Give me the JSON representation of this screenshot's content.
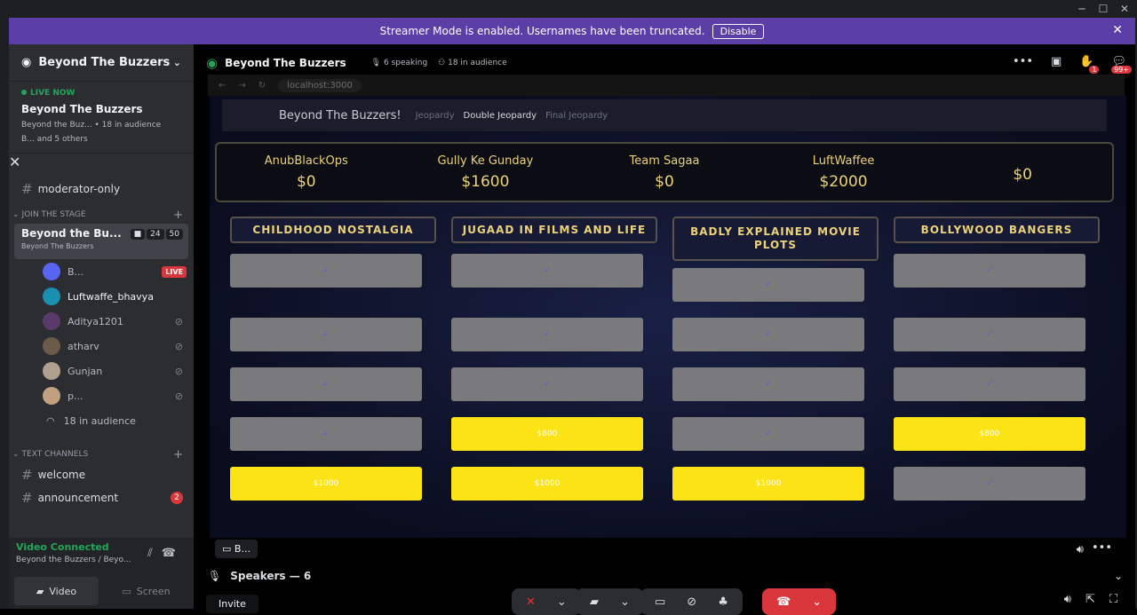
{
  "banner": {
    "text": "Streamer Mode is enabled. Usernames have been truncated.",
    "disable": "Disable"
  },
  "sidebar": {
    "server_name": "Beyond The Buzzers",
    "live": {
      "tag": "LIVE NOW",
      "name": "Beyond The Buzzers",
      "meta": "Beyond the Buz... • 18 in audience",
      "others": "B... and 5 others"
    },
    "channel_moderator": "moderator-only",
    "cat_stage": "JOIN THE STAGE",
    "stage_name": "Beyond the Bu...",
    "stage_sub": "Beyond The Buzzers",
    "stage_count1": "24",
    "stage_count2": "50",
    "users": [
      {
        "name": "B...",
        "live": "LIVE"
      },
      {
        "name": "Luftwaffe_bhavya"
      },
      {
        "name": "Aditya1201"
      },
      {
        "name": "atharv"
      },
      {
        "name": "Gunjan"
      },
      {
        "name": "p..."
      }
    ],
    "audience": "18 in audience",
    "cat_text": "TEXT CHANNELS",
    "channel_welcome": "welcome",
    "channel_announcement": "announcement",
    "announcement_badge": "2",
    "voice_connected": "Video Connected",
    "voice_sub": "Beyond the Buzzers / Beyo...",
    "btn_video": "Video",
    "btn_screen": "Screen"
  },
  "stage": {
    "title": "Beyond The Buzzers",
    "speaking": "6 speaking",
    "audience": "18 in audience",
    "notif_count": "1",
    "inbox_count": "99+",
    "url": "localhost:3000",
    "sharer": "B...",
    "speakers": "Speakers — 6",
    "invite": "Invite"
  },
  "game": {
    "brand": "Beyond The Buzzers!",
    "nav": [
      "Jeopardy",
      "Double Jeopardy",
      "Final Jeopardy"
    ],
    "teams": [
      {
        "name": "AnubBlackOps",
        "score": "$0"
      },
      {
        "name": "Gully Ke Gunday",
        "score": "$1600"
      },
      {
        "name": "Team Sagaa",
        "score": "$0"
      },
      {
        "name": "LuftWaffee",
        "score": "$2000"
      },
      {
        "name": "",
        "score": "$0"
      }
    ],
    "categories": [
      "CHILDHOOD NOSTALGIA",
      "JUGAAD IN FILMS AND LIFE",
      "BADLY EXPLAINED MOVIE PLOTS",
      "BOLLYWOOD BANGERS"
    ],
    "check": "✔",
    "open_cells": {
      "c1_r5": "$1000",
      "c2_r4": "$800",
      "c2_r5": "$1000",
      "c3_r5": "$1000",
      "c4_r4": "$800"
    }
  },
  "colors": {
    "banner": "#5b3ea6",
    "gold": "#ecd27a",
    "tile_open": "#fbe316",
    "tile_used": "#7a7a7c",
    "live_green": "#23a55a",
    "danger": "#da373c"
  }
}
